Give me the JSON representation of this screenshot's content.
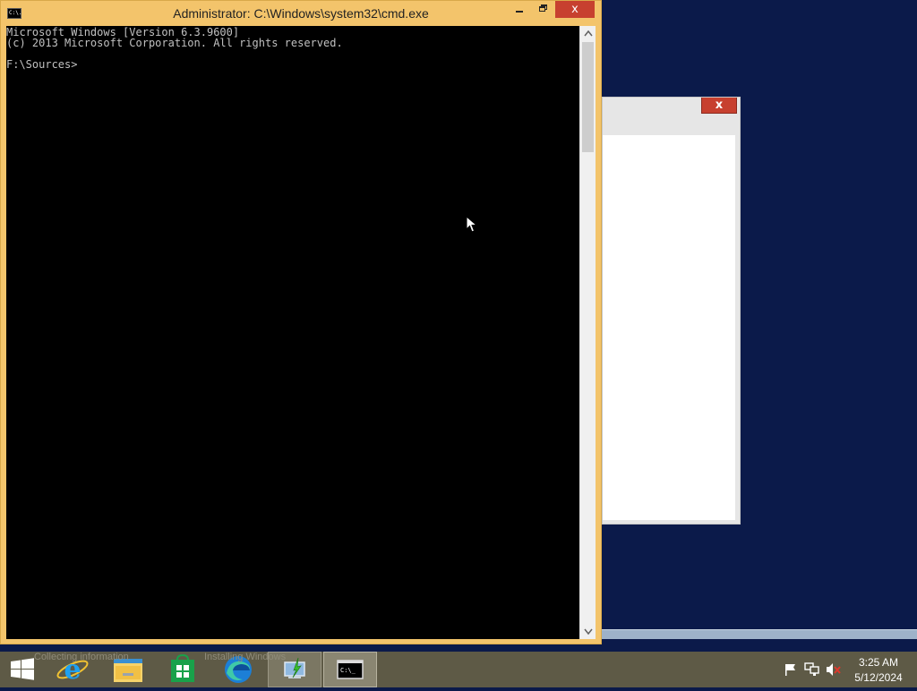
{
  "cmd_window": {
    "title": "Administrator: C:\\Windows\\system32\\cmd.exe",
    "icon_label": "C:\\.",
    "close_label": "x",
    "console_lines": [
      "Microsoft Windows [Version 6.3.9600]",
      "(c) 2013 Microsoft Corporation. All rights reserved.",
      "",
      "F:\\Sources>"
    ]
  },
  "setup_window": {
    "close_label": "x"
  },
  "taskbar": {
    "ghost_texts": [
      "Collecting information",
      "Installing Windows"
    ],
    "items": [
      {
        "name": "start-button",
        "icon": "windows-logo-icon"
      },
      {
        "name": "internet-explorer",
        "icon": "internet-explorer-icon"
      },
      {
        "name": "file-explorer",
        "icon": "folder-icon"
      },
      {
        "name": "windows-store",
        "icon": "store-icon"
      },
      {
        "name": "edge",
        "icon": "edge-icon"
      },
      {
        "name": "windows-setup",
        "icon": "setup-icon"
      },
      {
        "name": "command-prompt",
        "icon": "cmd-icon",
        "cmd_label": "C:\\_"
      }
    ],
    "tray": {
      "icons": [
        "flag-icon",
        "network-icon",
        "volume-muted-icon"
      ],
      "time": "3:25 AM",
      "date": "5/12/2024"
    }
  },
  "colors": {
    "desktop": "#0b1a4a",
    "window_frame": "#f3c46b",
    "close_red": "#c7402f",
    "taskbar": "#5e5a46"
  }
}
